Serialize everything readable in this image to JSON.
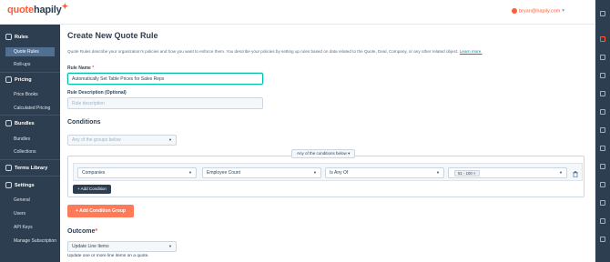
{
  "brand": {
    "part1": "quote",
    "part2": "hapily"
  },
  "header": {
    "user_email": "bryan@hapily.com"
  },
  "sidebar": {
    "sections": [
      {
        "label": "Rules",
        "items": [
          "Quote Rules",
          "Roll-ups"
        ]
      },
      {
        "label": "Pricing",
        "items": [
          "Price Books",
          "Calculated Pricing"
        ]
      },
      {
        "label": "Bundles",
        "items": [
          "Bundles",
          "Collections"
        ]
      },
      {
        "label": "Terms Library",
        "items": []
      },
      {
        "label": "Settings",
        "items": [
          "General",
          "Users",
          "API Keys",
          "Manage Subscription"
        ]
      }
    ]
  },
  "page": {
    "title": "Create New Quote Rule",
    "description": "Quote Rules describe your organization's policies and how you want to enforce them. You describe your policies by setting up rules based on data related to the Quote, Deal, Company, or any other related object.",
    "learn_more": "Learn more.",
    "rule_name_label": "Rule Name",
    "rule_name_required": "*",
    "rule_name_value": "Automatically Set Table Prices for Sales Reps",
    "rule_desc_label": "Rule Description (Optional)",
    "rule_desc_placeholder": "Rule description"
  },
  "conditions": {
    "heading": "Conditions",
    "groups_select": "Any of the groups below",
    "conditions_select": "Any of the conditions below",
    "row": {
      "object": "Companies",
      "property": "Employee Count",
      "operator": "Is Any Of",
      "value_tag": "51 - 100",
      "tag_remove": "×"
    },
    "add_condition": "+ Add Condition",
    "add_group": "+ Add Condition Group"
  },
  "outcome": {
    "heading": "Outcome",
    "required": "*",
    "select_value": "Update Line Items",
    "helper": "Update one or more line items on a quote."
  },
  "colors": {
    "accent": "#ff5c35",
    "nav_bg": "#2d3e50",
    "teal_focus": "#00bda5",
    "orange_button": "#ff7a59"
  }
}
